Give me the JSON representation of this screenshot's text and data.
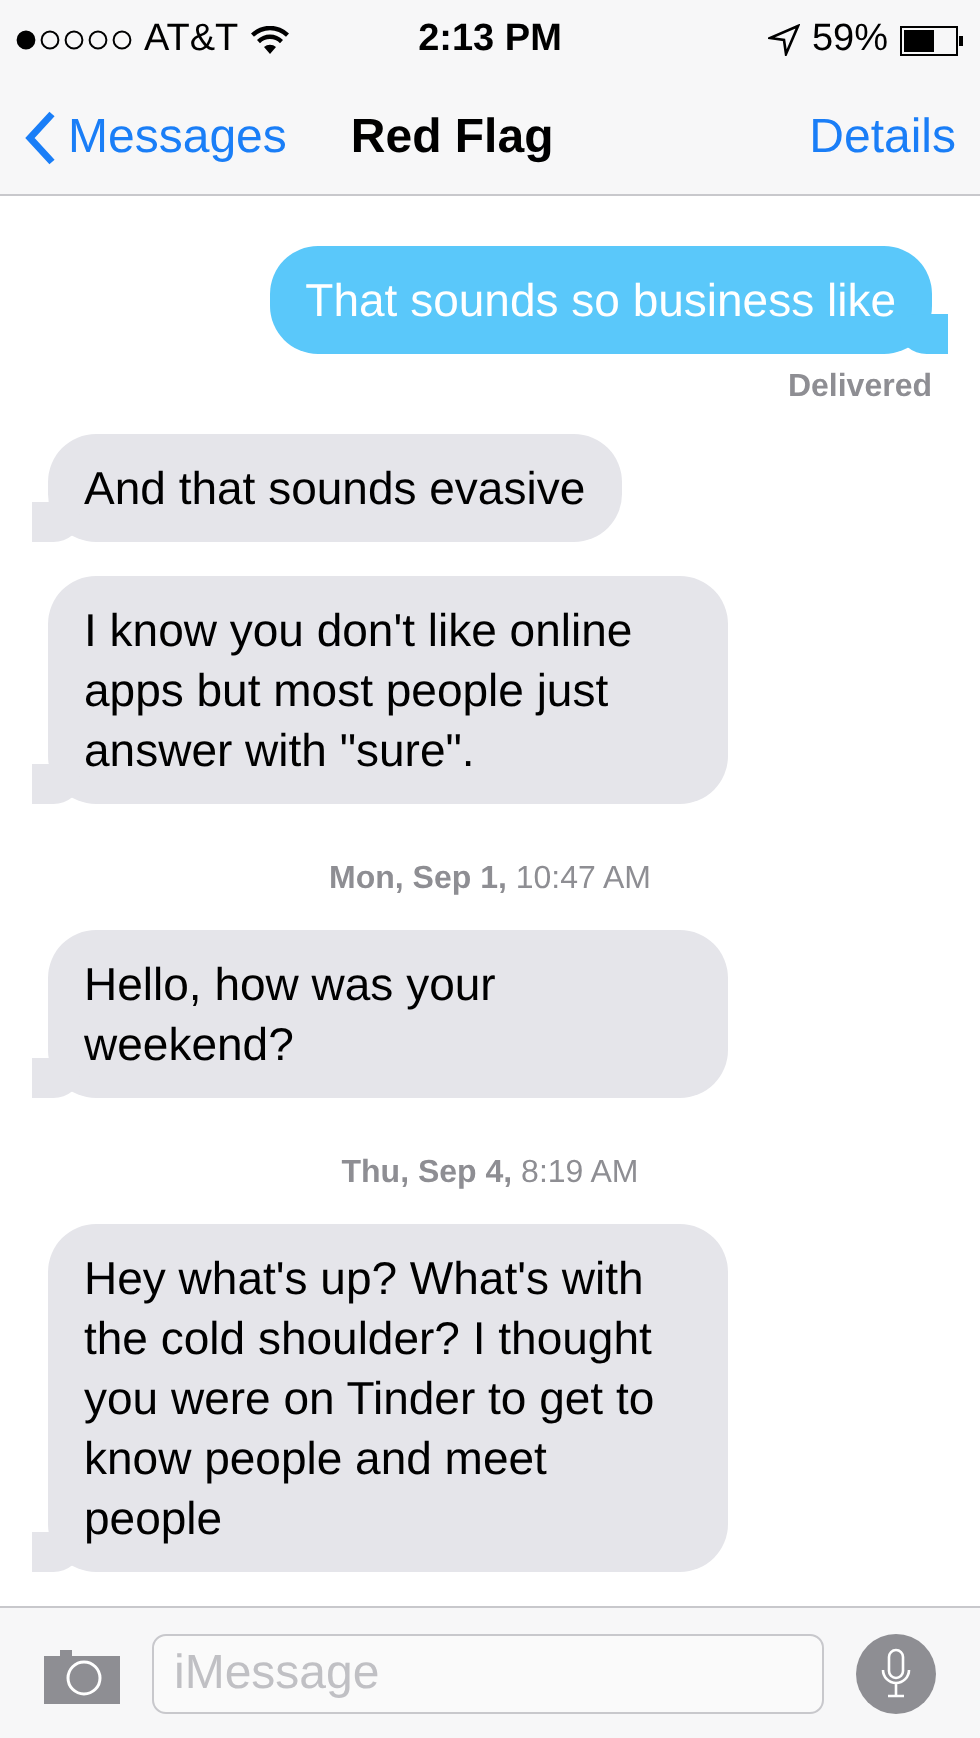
{
  "status_bar": {
    "carrier": "AT&T",
    "time": "2:13 PM",
    "battery": "59%"
  },
  "nav": {
    "back": "Messages",
    "title": "Red Flag",
    "action": "Details"
  },
  "messages": [
    {
      "kind": "sent",
      "text": "That sounds so business like"
    },
    {
      "kind": "status",
      "text": "Delivered"
    },
    {
      "kind": "received",
      "text": "And that sounds evasive"
    },
    {
      "kind": "received",
      "text": "I know you don't like online apps but most people just answer with \"sure\"."
    },
    {
      "kind": "timestamp",
      "text": "**Mon, Sep 1,** 10:47 AM"
    },
    {
      "kind": "received",
      "text": "Hello, how was your weekend?"
    },
    {
      "kind": "timestamp",
      "text": "**Thu, Sep 4,** 8:19 AM"
    },
    {
      "kind": "received",
      "text": "Hey what's up? What's with the cold shoulder? I thought you were on Tinder to get to know people and meet people"
    }
  ],
  "input": {
    "placeholder": "iMessage"
  }
}
